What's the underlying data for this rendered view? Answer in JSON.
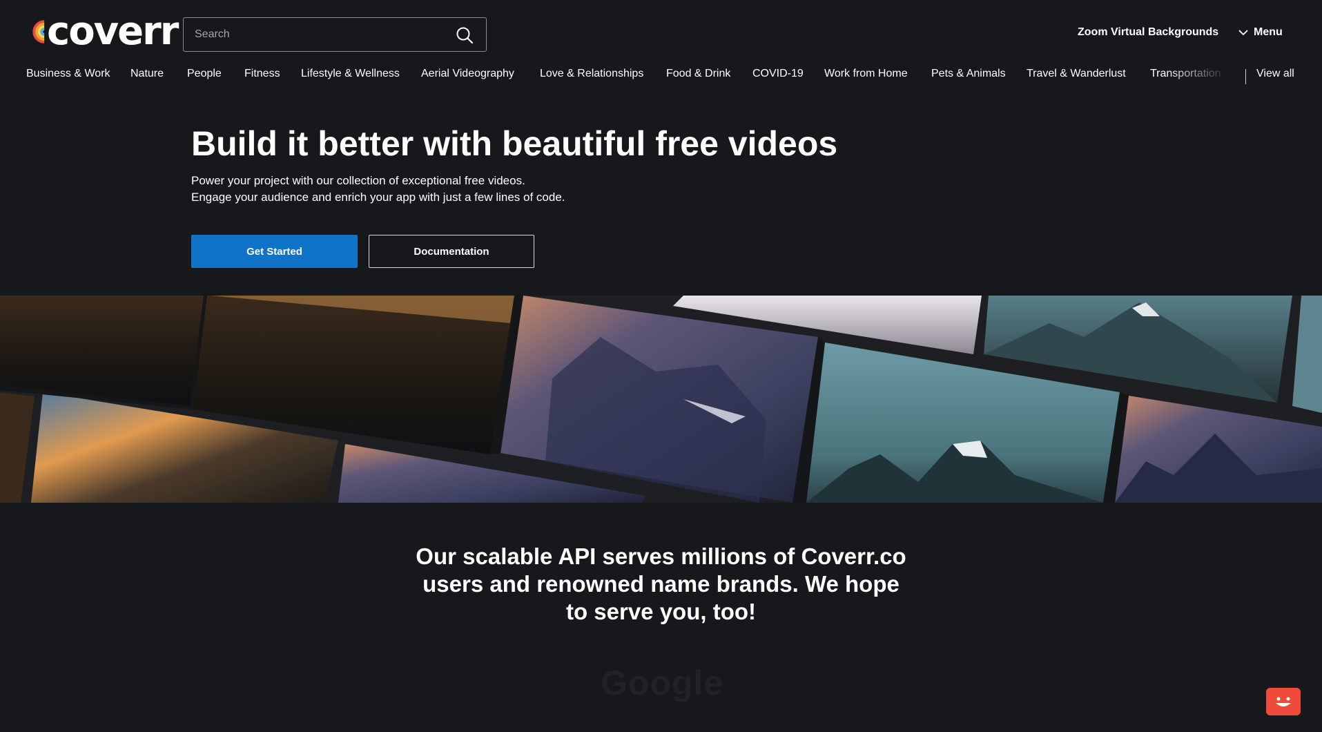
{
  "header": {
    "logo_text": "coverr",
    "search_placeholder": "Search",
    "zoom_link": "Zoom Virtual Backgrounds",
    "menu_label": "Menu"
  },
  "categories": [
    "Business & Work",
    "Nature",
    "People",
    "Fitness",
    "Lifestyle & Wellness",
    "Aerial Videography",
    "Love & Relationships",
    "Food & Drink",
    "COVID-19",
    "Work from Home",
    "Pets & Animals",
    "Travel & Wanderlust",
    "Transportation"
  ],
  "view_all": "View all",
  "hero": {
    "title": "Build it better with beautiful free videos",
    "subtitle_line1": "Power your project with our collection of exceptional free videos.",
    "subtitle_line2": "Engage your audience and enrich your app with just a few lines of code.",
    "primary_button": "Get Started",
    "secondary_button": "Documentation"
  },
  "api_section": {
    "text": "Our scalable API serves millions of Coverr.co users and renowned name brands. We hope to serve you, too!",
    "brand_logo": "Google"
  },
  "colors": {
    "background": "#16181b",
    "primary": "#0f74c7",
    "chat": "#f04a3b"
  }
}
